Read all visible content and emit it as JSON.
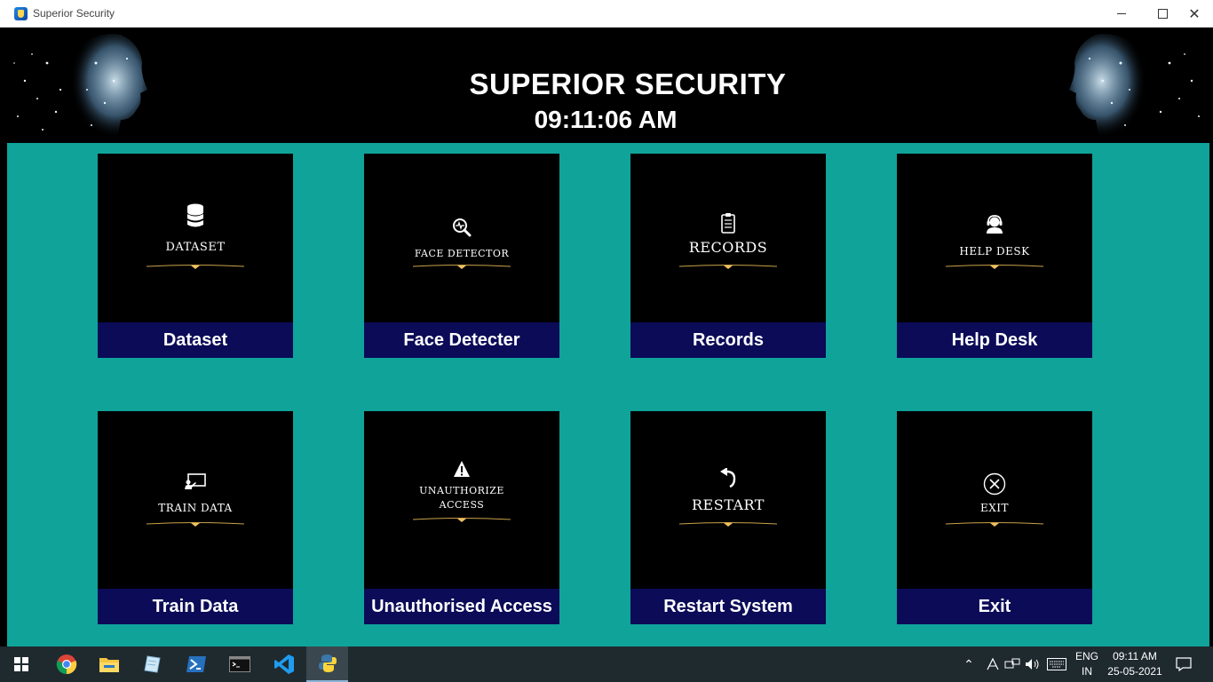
{
  "window": {
    "title": "Superior Security",
    "controls": {
      "minimize": "–",
      "maximize": "□",
      "close": "✕"
    }
  },
  "header": {
    "title": "SUPERIOR SECURITY",
    "time": "09:11:06 AM"
  },
  "tiles": [
    {
      "art_label": "DATASET",
      "icon": "database-icon",
      "button_label": "Dataset"
    },
    {
      "art_label": "FACE DETECTOR",
      "icon": "face-search-icon",
      "button_label": "Face Detecter"
    },
    {
      "art_label": "RECORDS",
      "icon": "clipboard-list-icon",
      "button_label": "Records"
    },
    {
      "art_label": "HELP DESK",
      "icon": "support-agent-icon",
      "button_label": "Help Desk"
    },
    {
      "art_label": "TRAIN DATA",
      "icon": "presentation-icon",
      "button_label": "Train Data"
    },
    {
      "art_label_line1": "UNAUTHORIZE",
      "art_label_line2": "ACCESS",
      "icon": "warning-icon",
      "button_label": "Unauthorised Access"
    },
    {
      "art_label": "RESTART",
      "icon": "restart-arrow-icon",
      "button_label": "Restart System"
    },
    {
      "art_label": "EXIT",
      "icon": "exit-circle-icon",
      "button_label": "Exit"
    }
  ],
  "taskbar": {
    "apps": [
      "chrome-icon",
      "file-explorer-icon",
      "notepad-icon",
      "powershell-icon",
      "terminal-icon",
      "vscode-icon",
      "python-icon"
    ],
    "language": {
      "line1": "ENG",
      "line2": "IN"
    },
    "clock": {
      "time": "09:11 AM",
      "date": "25-05-2021"
    }
  },
  "colors": {
    "teal": "#0fa39a",
    "label_bg": "#0b0b58",
    "header_bg": "#000000",
    "ornament": "#c9a24a"
  }
}
